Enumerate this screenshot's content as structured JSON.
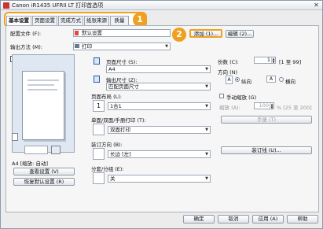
{
  "window": {
    "title": "Canon iR1435 UFRII LT 打印首选项",
    "close_glyph": "✕"
  },
  "tabs": [
    {
      "label": "基本设置",
      "active": true
    },
    {
      "label": "页面设置",
      "active": false
    },
    {
      "label": "完成方式",
      "active": false
    },
    {
      "label": "纸张来源",
      "active": false
    },
    {
      "label": "质量",
      "active": false
    }
  ],
  "callouts": {
    "tabs": "1",
    "add": "2"
  },
  "profile": {
    "label": "配置文件 (F):",
    "value": "默认设置",
    "add_button": "添加 (1)...",
    "edit_button": "编辑 (2)..."
  },
  "output_method": {
    "label": "输出方法 (M):",
    "value": "打印"
  },
  "preview": {
    "caption": "A4 [缩放: 自动]",
    "view_settings_button": "查看设置 (V)",
    "restore_defaults_button": "恢复默认设置 (R)"
  },
  "page_size": {
    "label": "页面尺寸 (S):",
    "value": "A4"
  },
  "output_size": {
    "label": "输出尺寸 (Z):",
    "value": "匹配页面尺寸"
  },
  "copies": {
    "label": "份数 (C):",
    "value": "1",
    "range": "[1 至 99]"
  },
  "orientation": {
    "label": "方向 (N)",
    "portrait_label": "纵向",
    "landscape_label": "横向",
    "selected": "portrait"
  },
  "page_layout": {
    "label": "页面布局 (L):",
    "value": "1合1",
    "icon_value": "1"
  },
  "manual_scaling": {
    "label": "手动缩放 (G)",
    "scale_label": "缩放 (A):",
    "scale_value": "100",
    "scale_range": "% [25 至 200]"
  },
  "watermark_button": "手册 (T)",
  "print_style": {
    "label": "单面/双面/手册打印 (T):",
    "value": "双面打印"
  },
  "binding_location": {
    "label": "装订方向 (B):",
    "value": "长边 [左]"
  },
  "gutter_button": "装订线 (U)...",
  "finishing": {
    "label": "分套/分组 (E):",
    "value": "关"
  },
  "footer": {
    "ok": "确定",
    "cancel": "取消",
    "apply": "应用 (A)",
    "help": "帮助"
  },
  "colors": {
    "accent": "#f0a01e",
    "panel": "#f6f6f6",
    "window": "#ececec"
  }
}
